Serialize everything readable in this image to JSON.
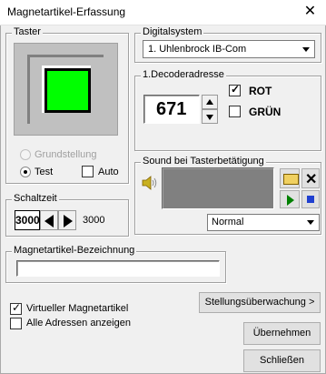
{
  "window": {
    "title": "Magnetartikel-Erfassung",
    "close_glyph": "✕"
  },
  "taster": {
    "label": "Taster",
    "lamp_color": "#00ff00",
    "radio_grundstellung": "Grundstellung",
    "radio_test": "Test",
    "auto_label": "Auto",
    "selected": "Test"
  },
  "schaltzeit": {
    "label": "Schaltzeit",
    "value": "3000",
    "display": "3000"
  },
  "digitalsystem": {
    "label": "Digitalsystem",
    "selected": "1. Uhlenbrock IB-Com"
  },
  "decoder": {
    "label": "1.Decoderadresse",
    "value": "671",
    "rot_label": "ROT",
    "rot_checked": true,
    "gruen_label": "GRÜN",
    "gruen_checked": false
  },
  "sound": {
    "label": "Sound bei Tasterbetätigung",
    "mode": "Normal"
  },
  "bezeichnung": {
    "label": "Magnetartikel-Bezeichnung",
    "value": ""
  },
  "options": {
    "virtuell_label": "Virtueller Magnetartikel",
    "virtuell_checked": true,
    "alle_label": "Alle Adressen anzeigen",
    "alle_checked": false
  },
  "buttons": {
    "stellung": "Stellungsüberwachung >",
    "uebernehmen": "Übernehmen",
    "schliessen": "Schließen"
  }
}
